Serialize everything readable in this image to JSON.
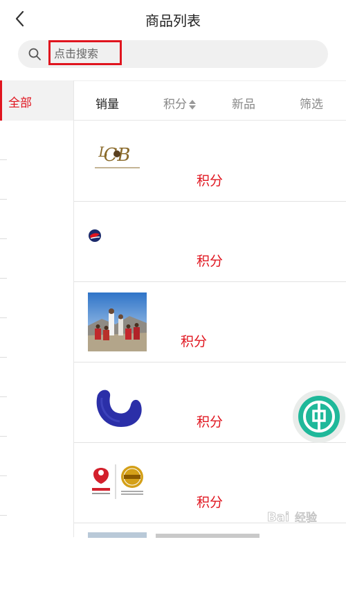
{
  "header": {
    "title": "商品列表",
    "back_icon": "chevron-left-icon"
  },
  "search": {
    "placeholder": "点击搜索",
    "value": "",
    "icon": "search-icon",
    "highlight_color": "#e0141e"
  },
  "sidebar": {
    "items": [
      {
        "label": "全部",
        "active": true
      }
    ]
  },
  "sort": {
    "items": [
      {
        "label": "销量",
        "active": true
      },
      {
        "label": "积分",
        "active": false,
        "icon": "sort-updown-icon"
      },
      {
        "label": "新品",
        "active": false
      },
      {
        "label": "筛选",
        "active": false
      }
    ]
  },
  "products": [
    {
      "price_label": "积分",
      "image": "club-logo"
    },
    {
      "price_label": "积分",
      "image": "china-eastern-logo"
    },
    {
      "price_label": "积分",
      "image": "family-photo"
    },
    {
      "price_label": "积分",
      "image": "neck-pillow"
    },
    {
      "price_label": "积分",
      "image": "hainan-airlines-logo"
    }
  ],
  "floating_button": {
    "icon": "bank-icon"
  },
  "watermark": {
    "text": "Bai经验"
  },
  "colors": {
    "accent": "#e0141e",
    "float_ring": "#1fb89a"
  }
}
